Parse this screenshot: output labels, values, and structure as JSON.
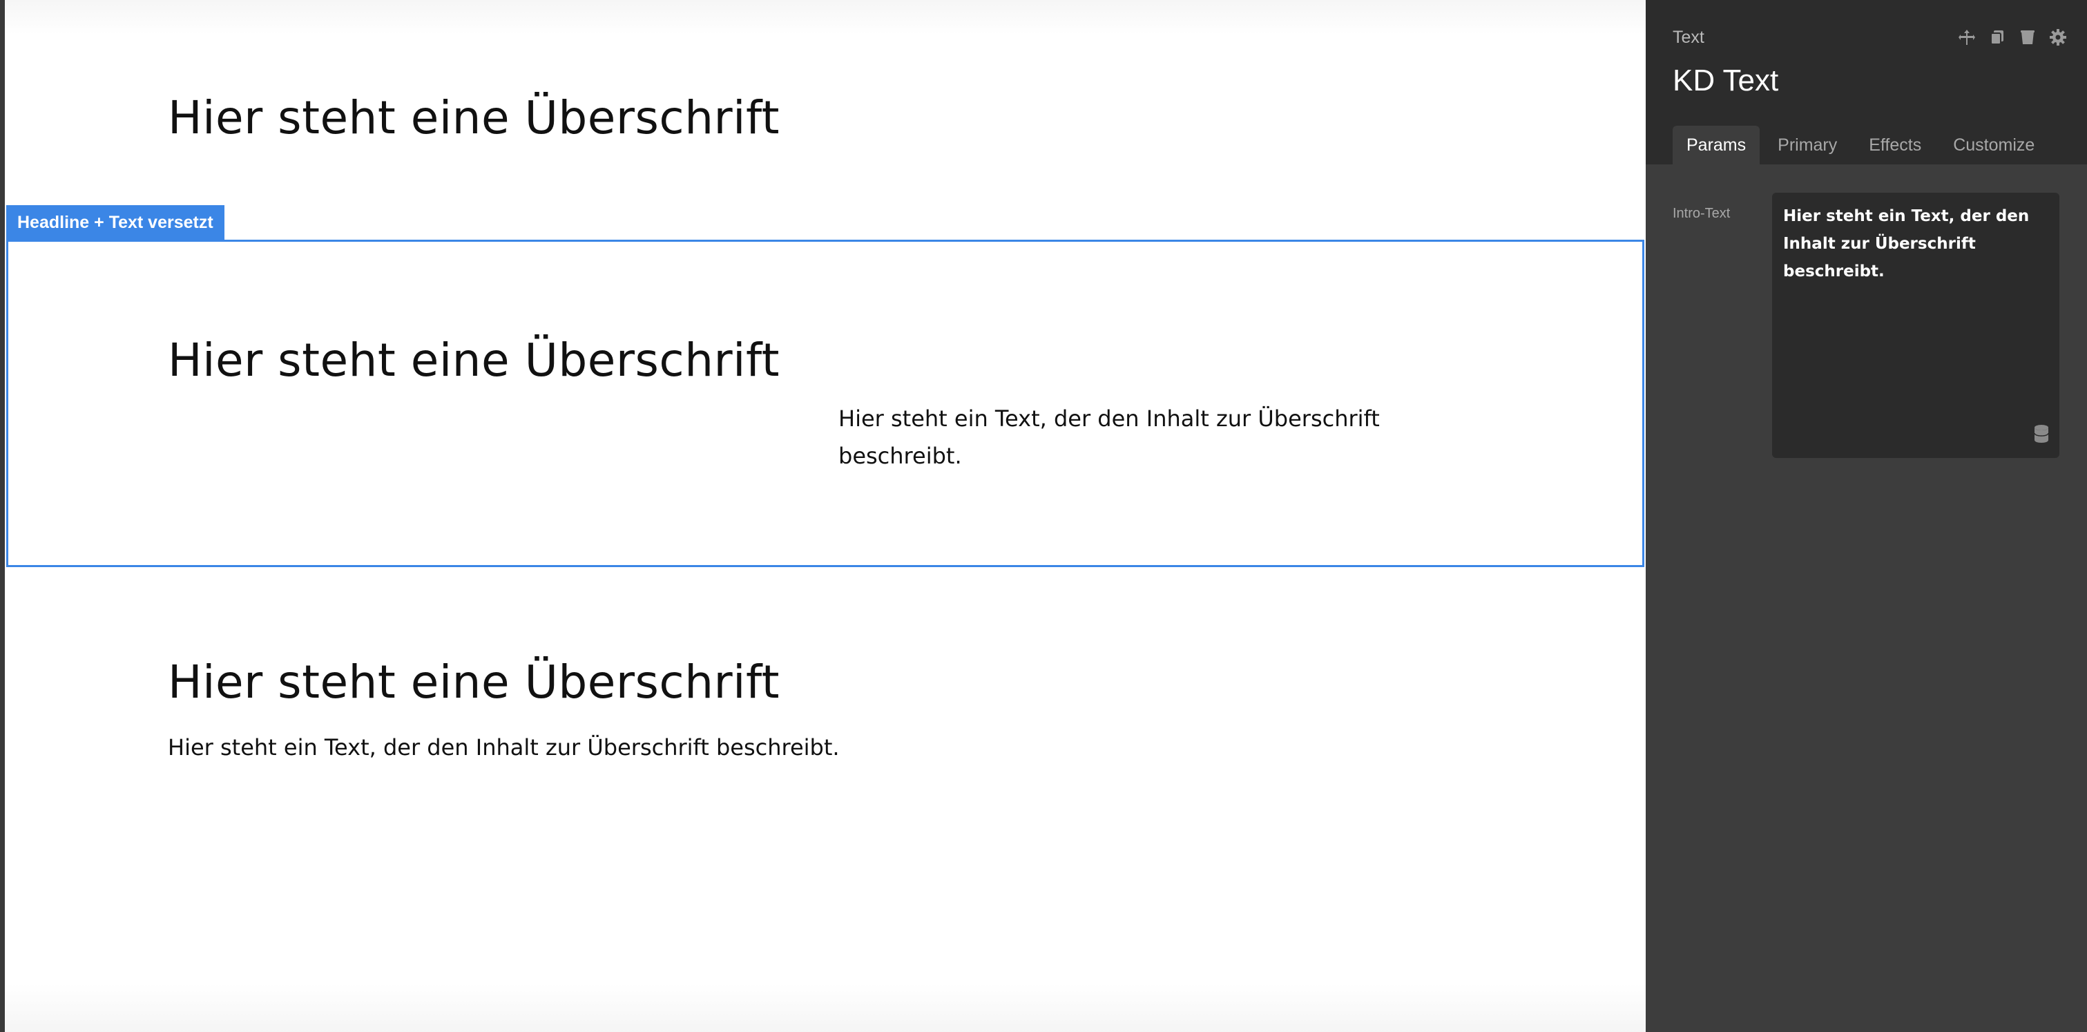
{
  "canvas": {
    "blocks": [
      {
        "headline": "Hier steht eine Überschrift"
      },
      {
        "headline": "Hier steht eine Überschrift",
        "text": "Hier steht ein Text, der den Inhalt zur Überschrift beschreibt.",
        "selection_label": "Headline + Text versetzt",
        "selected": true
      },
      {
        "headline": "Hier steht eine Überschrift",
        "text": "Hier steht ein Text, der den Inhalt zur Überschrift beschreibt."
      }
    ],
    "selection_color": "#3b86e6"
  },
  "panel": {
    "type_label": "Text",
    "title": "KD Text",
    "actions": [
      "move-icon",
      "duplicate-icon",
      "delete-icon",
      "settings-icon"
    ],
    "tabs": [
      {
        "label": "Params",
        "active": true
      },
      {
        "label": "Primary",
        "active": false
      },
      {
        "label": "Effects",
        "active": false
      },
      {
        "label": "Customize",
        "active": false
      }
    ],
    "fields": [
      {
        "label": "Intro-Text",
        "value": "Hier steht ein Text, der den Inhalt zur Überschrift beschreibt.",
        "icon": "database-icon"
      }
    ]
  }
}
